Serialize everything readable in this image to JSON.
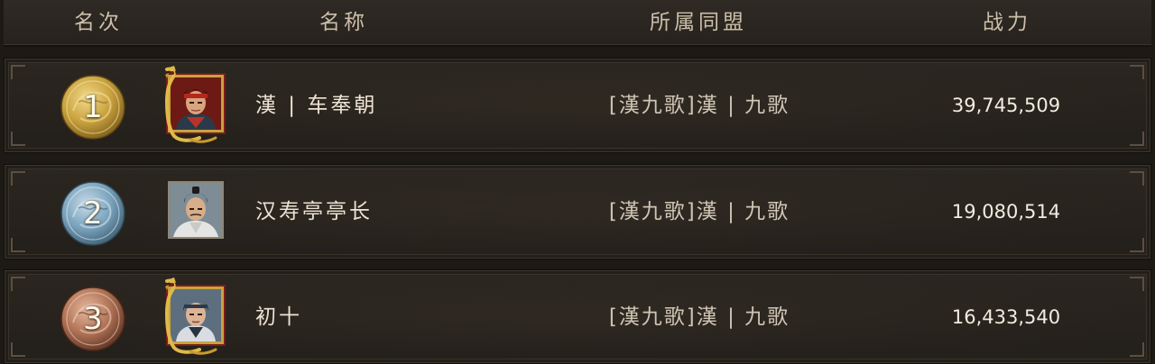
{
  "header": {
    "rank": "名次",
    "name": "名称",
    "alliance": "所属同盟",
    "power": "战力"
  },
  "colors": {
    "gold_medal": "#c9a23e",
    "silver_medal": "#7aa3bd",
    "bronze_medal": "#b07256",
    "row_bg": "#26221d",
    "text": "#ece3d3"
  },
  "rows": [
    {
      "rank": "1",
      "medal": "gold-medal-icon",
      "avatar_frame": "gold-dragon-frame",
      "name": "漢 | 车奉朝",
      "alliance": "[漢九歌]漢 | 九歌",
      "power": "39,745,509"
    },
    {
      "rank": "2",
      "medal": "silver-medal-icon",
      "avatar_frame": "plain-frame",
      "name": "汉寿亭亭长",
      "alliance": "[漢九歌]漢 | 九歌",
      "power": "19,080,514"
    },
    {
      "rank": "3",
      "medal": "bronze-medal-icon",
      "avatar_frame": "gold-dragon-frame",
      "name": "初十",
      "alliance": "[漢九歌]漢 | 九歌",
      "power": "16,433,540"
    }
  ]
}
